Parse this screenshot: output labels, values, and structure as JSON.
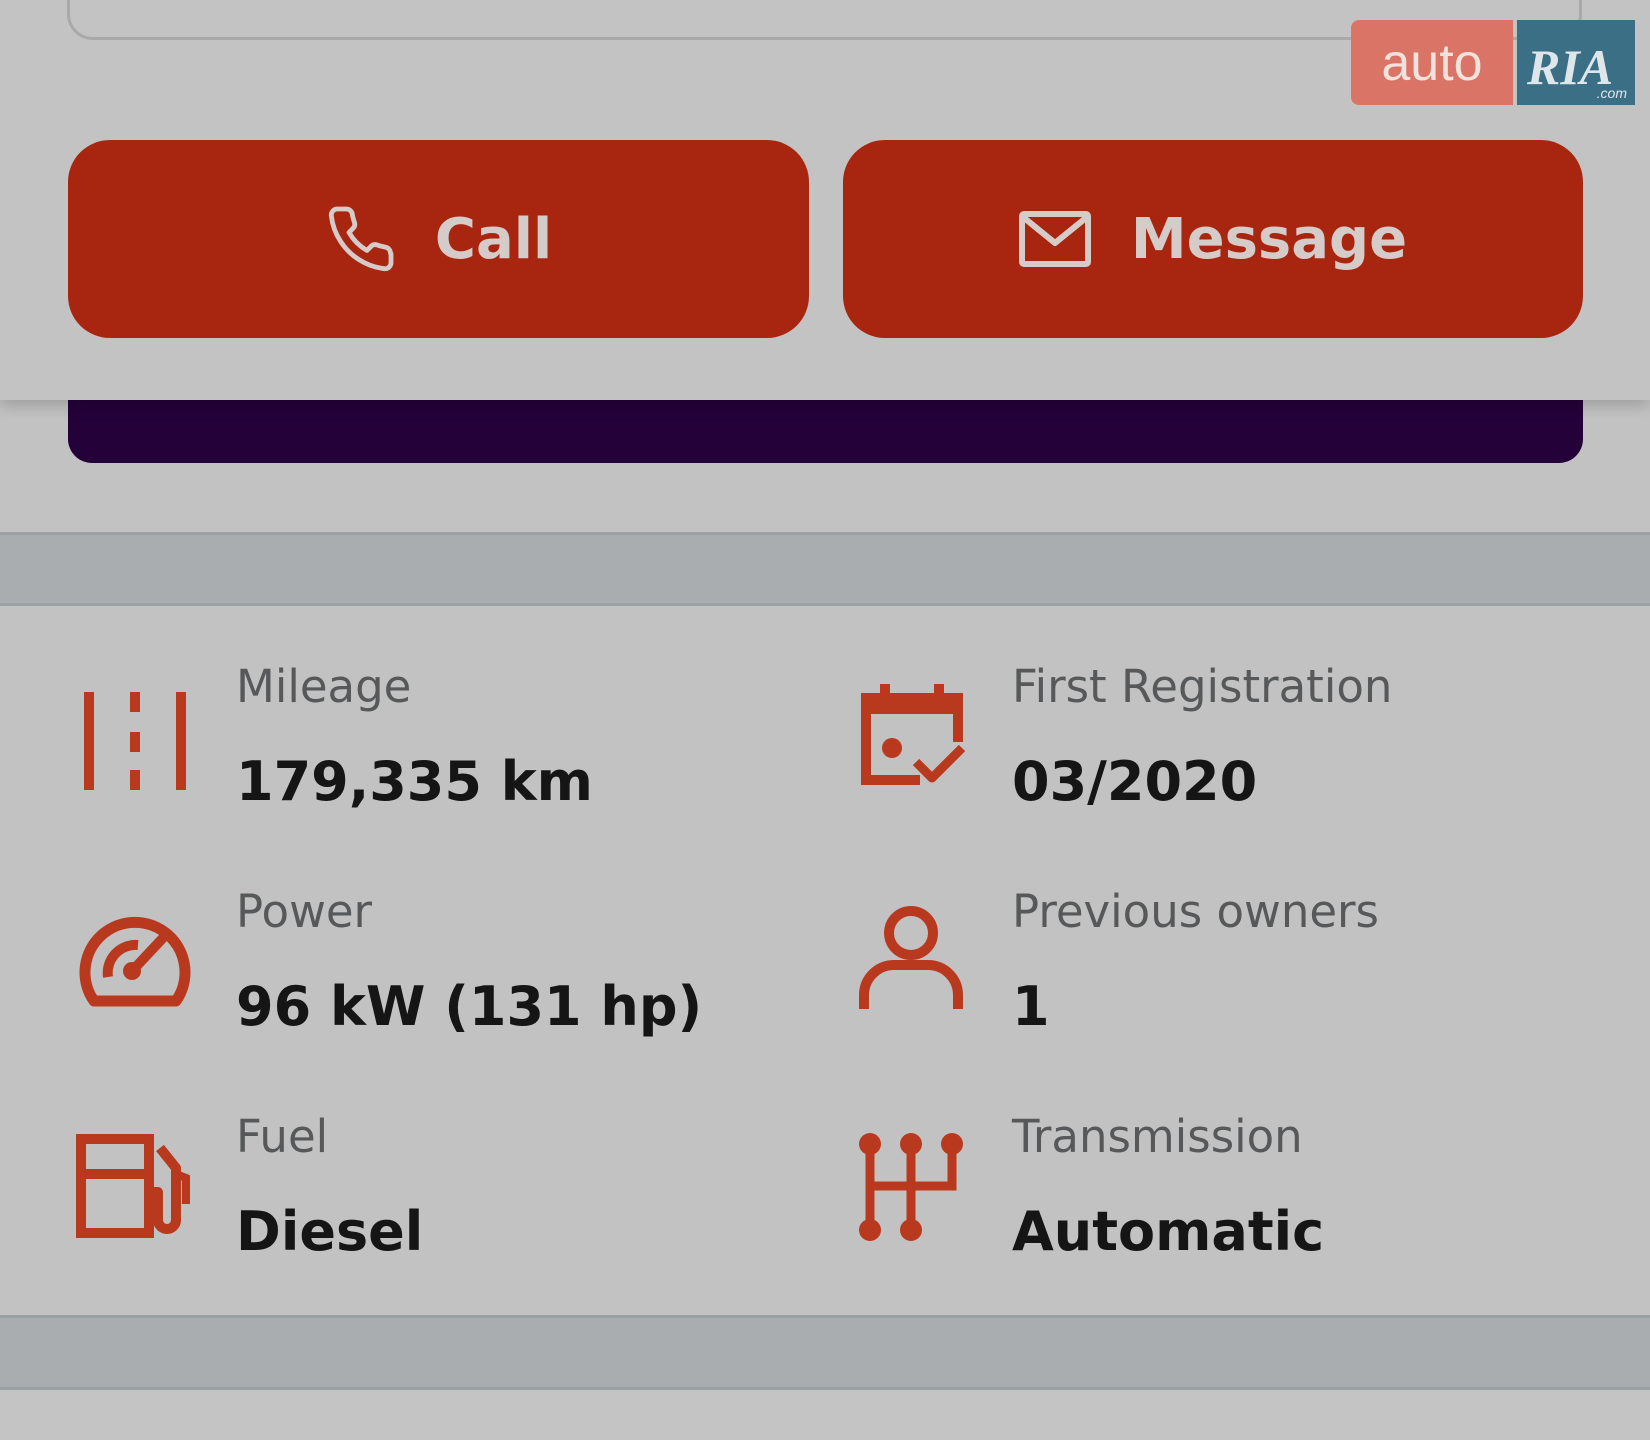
{
  "actions": {
    "call_label": "Call",
    "message_label": "Message"
  },
  "logo": {
    "auto_text": "auto",
    "ria_text": "RIA",
    "ria_suffix": ".com"
  },
  "specs": {
    "mileage": {
      "label": "Mileage",
      "value": "179,335 km"
    },
    "first_registration": {
      "label": "First Registration",
      "value": "03/2020"
    },
    "power": {
      "label": "Power",
      "value": "96 kW (131 hp)"
    },
    "previous_owners": {
      "label": "Previous owners",
      "value": "1"
    },
    "fuel": {
      "label": "Fuel",
      "value": "Diesel"
    },
    "transmission": {
      "label": "Transmission",
      "value": "Automatic"
    }
  },
  "colors": {
    "accent": "#a8260f",
    "icon": "#b9391f",
    "promo_bar": "#25013a"
  },
  "icons": [
    "phone-icon",
    "mail-icon",
    "road-icon",
    "calendar-check-icon",
    "speedometer-icon",
    "person-icon",
    "fuel-pump-icon",
    "gear-shift-icon"
  ]
}
